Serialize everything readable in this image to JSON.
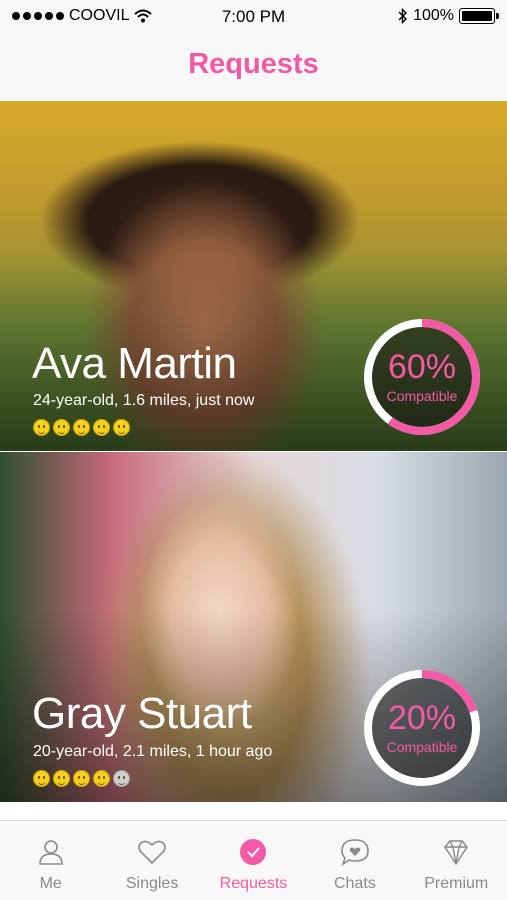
{
  "status_bar": {
    "carrier": "COOVIL",
    "time": "7:00 PM",
    "battery": "100%"
  },
  "header": {
    "title": "Requests"
  },
  "requests": [
    {
      "name": "Ava Martin",
      "meta": "24-year-old, 1.6 miles, just now",
      "compatibility_percent": 60,
      "compatibility_text": "60%",
      "compatibility_label": "Compatible",
      "rating_filled": 5,
      "rating_total": 5
    },
    {
      "name": "Gray Stuart",
      "meta": "20-year-old, 2.1 miles, 1 hour ago",
      "compatibility_percent": 20,
      "compatibility_text": "20%",
      "compatibility_label": "Compatible",
      "rating_filled": 4,
      "rating_total": 5
    }
  ],
  "tabs": [
    {
      "label": "Me",
      "icon": "person-icon",
      "active": false
    },
    {
      "label": "Singles",
      "icon": "heart-icon",
      "active": false
    },
    {
      "label": "Requests",
      "icon": "check-circle-icon",
      "active": true
    },
    {
      "label": "Chats",
      "icon": "chat-heart-icon",
      "active": false
    },
    {
      "label": "Premium",
      "icon": "diamond-icon",
      "active": false
    }
  ],
  "colors": {
    "accent": "#f35aa5",
    "inactive_tab": "#8a8a8a",
    "bar_background": "#f8f8f8"
  }
}
